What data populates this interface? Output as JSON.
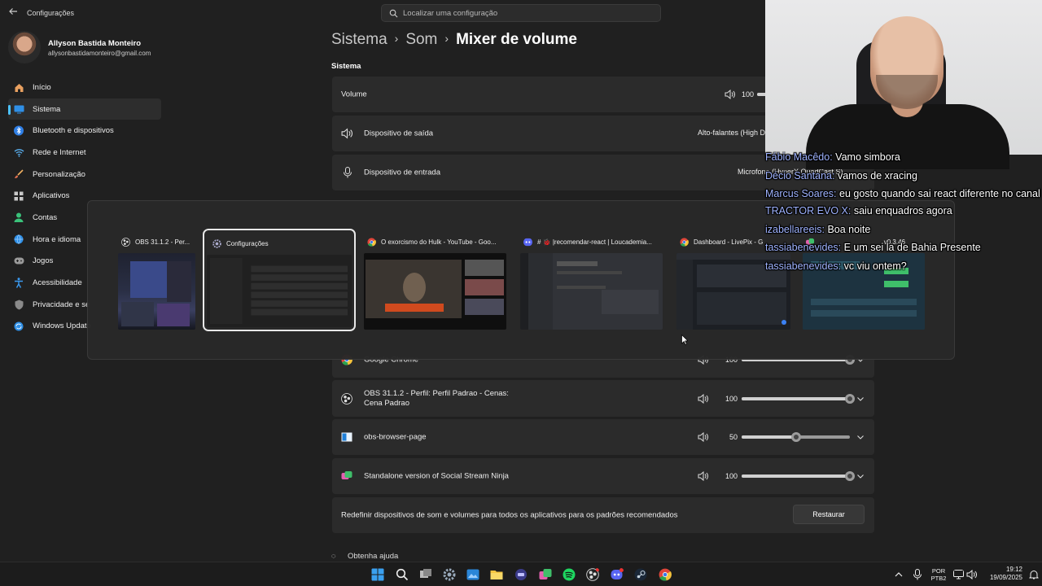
{
  "window": {
    "app_title": "Configurações"
  },
  "search": {
    "placeholder": "Localizar uma configuração"
  },
  "profile": {
    "name": "Allyson Bastida Monteiro",
    "email": "allysonbastidamonteiro@gmail.com"
  },
  "sidebar": {
    "items": [
      {
        "label": "Início",
        "icon": "home-icon"
      },
      {
        "label": "Sistema",
        "icon": "system-icon",
        "active": true
      },
      {
        "label": "Bluetooth e dispositivos",
        "icon": "bluetooth-icon"
      },
      {
        "label": "Rede e Internet",
        "icon": "wifi-icon"
      },
      {
        "label": "Personalização",
        "icon": "brush-icon"
      },
      {
        "label": "Aplicativos",
        "icon": "apps-icon"
      },
      {
        "label": "Contas",
        "icon": "account-icon"
      },
      {
        "label": "Hora e idioma",
        "icon": "globe-icon"
      },
      {
        "label": "Jogos",
        "icon": "gamepad-icon"
      },
      {
        "label": "Acessibilidade",
        "icon": "accessibility-icon"
      },
      {
        "label": "Privacidade e se",
        "icon": "shield-icon"
      },
      {
        "label": "Windows Update",
        "icon": "update-icon"
      }
    ]
  },
  "breadcrumb": {
    "level1": "Sistema",
    "level2": "Som",
    "current": "Mixer de volume"
  },
  "main": {
    "section_title": "Sistema",
    "volume": {
      "label": "Volume",
      "value": "100"
    },
    "output": {
      "label": "Dispositivo de saída",
      "value": "Alto-falantes (High D"
    },
    "input": {
      "label": "Dispositivo de entrada",
      "value": "Microfone (HyperX QuadCast S)"
    },
    "apps": [
      {
        "name": "Google Chrome",
        "value": "100",
        "level": 1.0
      },
      {
        "name": "OBS 31.1.2 - Perfil: Perfil Padrao - Cenas: Cena Padrao",
        "value": "100",
        "level": 1.0
      },
      {
        "name": "obs-browser-page",
        "value": "50",
        "level": 0.5
      },
      {
        "name": "Standalone version of Social Stream Ninja",
        "value": "100",
        "level": 1.0
      }
    ],
    "reset": {
      "label": "Redefinir dispositivos de som e volumes para todos os aplicativos para os padrões recomendados",
      "button": "Restaurar"
    },
    "help": "Obtenha ajuda"
  },
  "alttab": {
    "windows": [
      {
        "title": "OBS 31.1.2 - Per...",
        "icon": "obs-icon"
      },
      {
        "title": "Configurações",
        "icon": "settings-icon",
        "selected": true
      },
      {
        "title": "O exorcismo do Hulk - YouTube - Goo...",
        "icon": "chrome-icon"
      },
      {
        "title": "# 🐞 |recomendar-react | Loucademia...",
        "icon": "discord-icon"
      },
      {
        "title": "Dashboard - LivePix - G",
        "icon": "chrome-icon"
      },
      {
        "title": "v0.3.46",
        "icon": "social-stream-icon"
      }
    ]
  },
  "chat": [
    {
      "user": "Fábio Macêdo:",
      "message": "Vamo simbora"
    },
    {
      "user": "Décio Santana:",
      "message": "vamos de xracing"
    },
    {
      "user": "Marcus Soares:",
      "message": "eu gosto quando sai react diferente no canal"
    },
    {
      "user": "TRACTOR EVO X:",
      "message": "saiu enquadros agora"
    },
    {
      "user": "izabellareeis:",
      "message": "Boa noite"
    },
    {
      "user": "tassiabenevides:",
      "message": "E um sei la de Bahia Presente"
    },
    {
      "user": "tassiabenevides:",
      "message": "vc viu ontem?"
    }
  ],
  "taskbar": {
    "lang_line1": "POR",
    "lang_line2": "PTB2",
    "time": "19:12",
    "date": "19/09/2025"
  },
  "colors": {
    "accent": "#4cc2ff",
    "background": "#202020",
    "card": "#2b2b2b",
    "chat_user": "#9fb3ff"
  }
}
